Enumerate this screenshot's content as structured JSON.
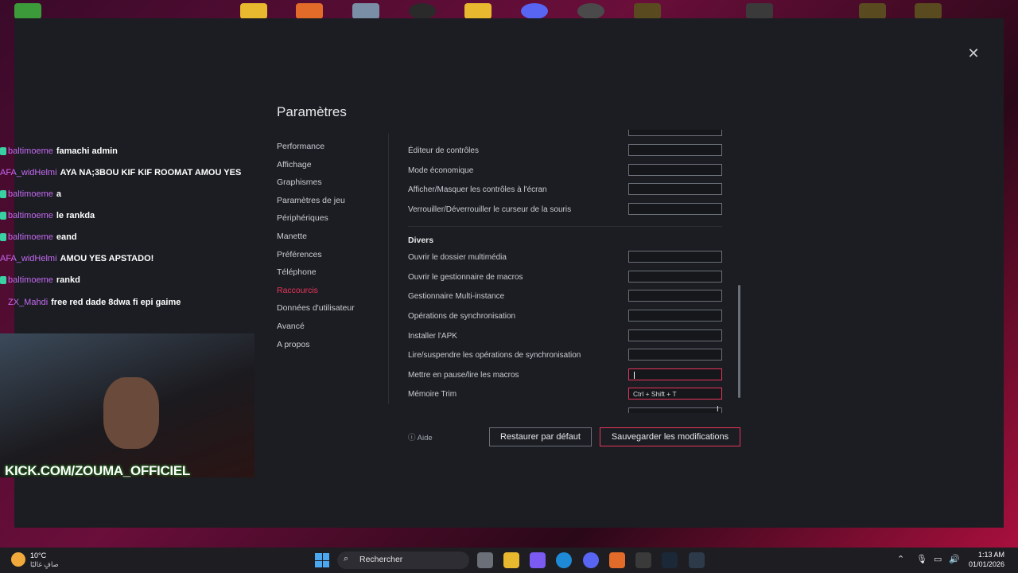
{
  "window": {
    "title": "Paramètres"
  },
  "nav": [
    {
      "label": "Performance",
      "active": false
    },
    {
      "label": "Affichage",
      "active": false
    },
    {
      "label": "Graphismes",
      "active": false
    },
    {
      "label": "Paramètres de jeu",
      "active": false
    },
    {
      "label": "Périphériques",
      "active": false
    },
    {
      "label": "Manette",
      "active": false
    },
    {
      "label": "Préférences",
      "active": false
    },
    {
      "label": "Téléphone",
      "active": false
    },
    {
      "label": "Raccourcis",
      "active": true
    },
    {
      "label": "Données d'utilisateur",
      "active": false
    },
    {
      "label": "Avancé",
      "active": false
    },
    {
      "label": "A propos",
      "active": false
    }
  ],
  "shortcuts": {
    "top_rows": [
      {
        "label": "Éditeur de contrôles",
        "value": ""
      },
      {
        "label": "Mode économique",
        "value": ""
      },
      {
        "label": "Afficher/Masquer les contrôles à l'écran",
        "value": ""
      },
      {
        "label": "Verrouiller/Déverrouiller le curseur de la souris",
        "value": ""
      }
    ],
    "section_title": "Divers",
    "divers_rows": [
      {
        "label": "Ouvrir le dossier multimédia",
        "value": ""
      },
      {
        "label": "Ouvrir le gestionnaire de macros",
        "value": ""
      },
      {
        "label": "Gestionnaire Multi-instance",
        "value": ""
      },
      {
        "label": "Opérations de synchronisation",
        "value": ""
      },
      {
        "label": "Installer l'APK",
        "value": ""
      },
      {
        "label": "Lire/suspendre les opérations de synchronisation",
        "value": ""
      },
      {
        "label": "Mettre en pause/lire les macros",
        "value": "",
        "focused": true
      },
      {
        "label": "Mémoire Trim",
        "value": "Ctrl + Shift + T"
      }
    ]
  },
  "footer": {
    "help": "Aide",
    "restore_button": "Restaurer par défaut",
    "save_button": "Sauvegarder les modifications"
  },
  "chat": [
    {
      "user": "baltimoeme",
      "message": "famachi admin"
    },
    {
      "user": "AFA_widHelmi",
      "message": "AYA NA;3BOU KIF KIF ROOMAT AMOU YES"
    },
    {
      "user": "baltimoeme",
      "message": "a"
    },
    {
      "user": "baltimoeme",
      "message": "le rankda"
    },
    {
      "user": "baltimoeme",
      "message": "eand"
    },
    {
      "user": "AFA_widHelmi",
      "message": "AMOU YES APSTADO!"
    },
    {
      "user": "baltimoeme",
      "message": "rankd"
    },
    {
      "user": "ZX_Mahdi",
      "message": "free red dade 8dwa fi epi gaime"
    }
  ],
  "stream_overlay": {
    "kick_url": "KICK.COM/ZOUMA_OFFICIEL"
  },
  "taskbar": {
    "temperature": "10°C",
    "weather_desc": "صافٍ غالبًا",
    "search_placeholder": "Recherche",
    "search_label": "Rechercher",
    "time": "1:13 AM",
    "date": "01/01/2026"
  },
  "colors": {
    "accent": "#e8355a",
    "window_bg": "#1b1d22",
    "chat_user": "#c46af0"
  }
}
